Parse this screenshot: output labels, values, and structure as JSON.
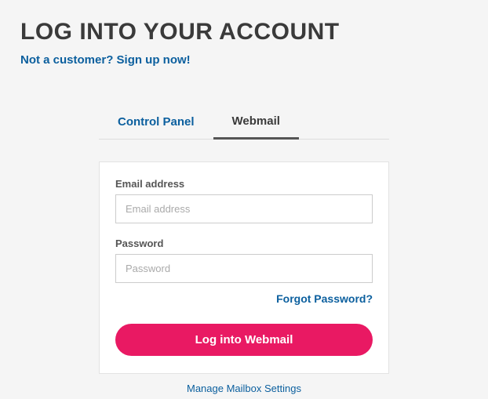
{
  "header": {
    "title": "LOG INTO YOUR ACCOUNT",
    "signup_text": "Not a customer? Sign up now!"
  },
  "tabs": {
    "control_panel": "Control Panel",
    "webmail": "Webmail"
  },
  "form": {
    "email_label": "Email address",
    "email_placeholder": "Email address",
    "password_label": "Password",
    "password_placeholder": "Password",
    "forgot_password": "Forgot Password?",
    "submit_label": "Log into Webmail"
  },
  "footer": {
    "manage_link": "Manage Mailbox Settings"
  }
}
